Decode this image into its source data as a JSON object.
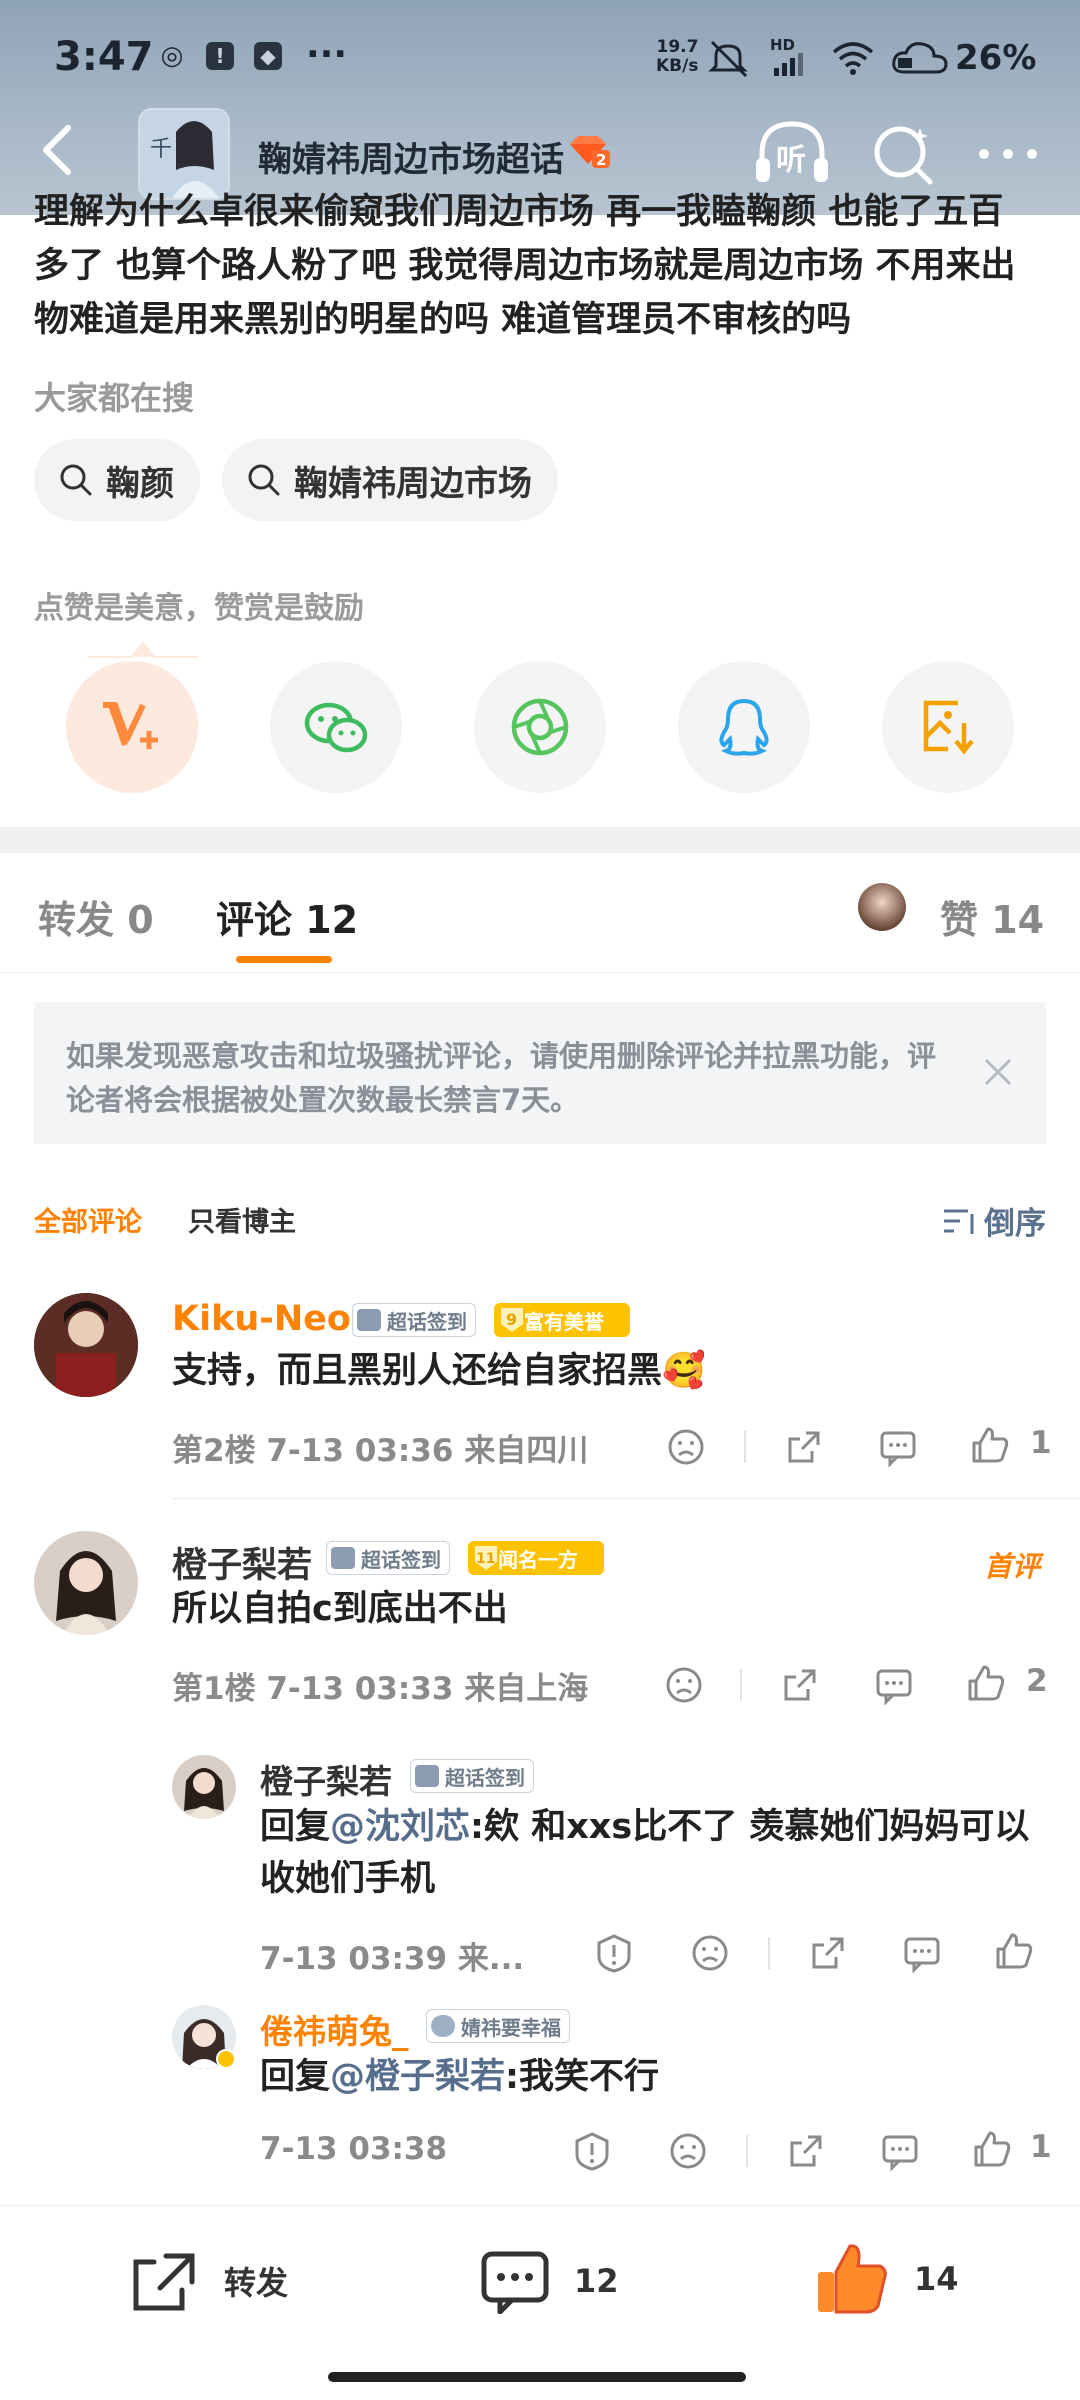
{
  "status_bar": {
    "time": "3:47",
    "speed_value": "19.7",
    "speed_unit": "KB/s",
    "battery": "26%",
    "signal_label": "HD"
  },
  "nav": {
    "title": "鞠婧祎周边市场超话",
    "listen_label": "听",
    "gem_level": "2"
  },
  "post": {
    "text_line1": "理解为什么卓很来偷窥我们周边市场 再一我瞌鞠颜 也能了五百",
    "text_line2": "多了 也算个路人粉了吧 我觉得周边市场就是周边市场 不用来出",
    "text_line3": "物难道是用来黑别的明星的吗 难道管理员不审核的吗"
  },
  "search_hint": "大家都在搜",
  "search_chips": [
    "鞠颜",
    "鞠婧祎周边市场"
  ],
  "like_hint": "点赞是美意，赞赏是鼓励",
  "share_options": [
    {
      "icon": "v-plus-icon",
      "color": "#ff8a3d"
    },
    {
      "icon": "wechat-icon",
      "color": "#3dbb5e"
    },
    {
      "icon": "moments-icon",
      "color": "#55c55e"
    },
    {
      "icon": "qq-icon",
      "color": "#2ba5ea"
    },
    {
      "icon": "save-image-icon",
      "color": "#f4a100"
    }
  ],
  "tabs": {
    "repost": "转发 0",
    "comment": "评论 12",
    "like": "赞 14"
  },
  "notice": "如果发现恶意攻击和垃圾骚扰评论，请使用删除评论并拉黑功能，评论者将会根据被处置次数最长禁言7天。",
  "filters": {
    "all": "全部评论",
    "owner_only": "只看博主",
    "sort": "倒序"
  },
  "comments": [
    {
      "name": "Kiku-Neo",
      "name_color": "#ff8200",
      "sign_tag": "超话签到",
      "honor_tag": "富有美誉",
      "honor_level": "9",
      "text": "支持，而且黑别人还给自家招黑🥰",
      "meta": "第2楼  7-13 03:36  来自四川",
      "likes": "1"
    },
    {
      "name": "橙子梨若",
      "name_color": "#333333",
      "sign_tag": "超话签到",
      "honor_tag": "闻名一方",
      "honor_level": "11",
      "first_badge": "首评",
      "text": "所以自拍c到底出不出",
      "meta": "第1楼  7-13 03:33  来自上海",
      "likes": "2"
    }
  ],
  "replies": [
    {
      "name": "橙子梨若",
      "name_color": "#333333",
      "sign_tag": "超话签到",
      "prefix": "回复",
      "mention": "@沈刘芯",
      "text_line1": ":欸 和xxs比不了 羡慕她们妈妈可以",
      "text_line2": "收她们手机",
      "meta": "7-13 03:39  来...",
      "likes": ""
    },
    {
      "name": "倦祎萌兔_",
      "name_color": "#ff8200",
      "sign_tag": "婧祎要幸福",
      "prefix": "回复",
      "mention": "@橙子梨若",
      "text_line1": ":我笑不行",
      "meta": "7-13 03:38",
      "likes": "1"
    }
  ],
  "bottom_bar": {
    "repost_label": "转发",
    "comment_count": "12",
    "like_count": "14"
  },
  "colors": {
    "accent": "#ff8200",
    "link": "#576d8c"
  }
}
